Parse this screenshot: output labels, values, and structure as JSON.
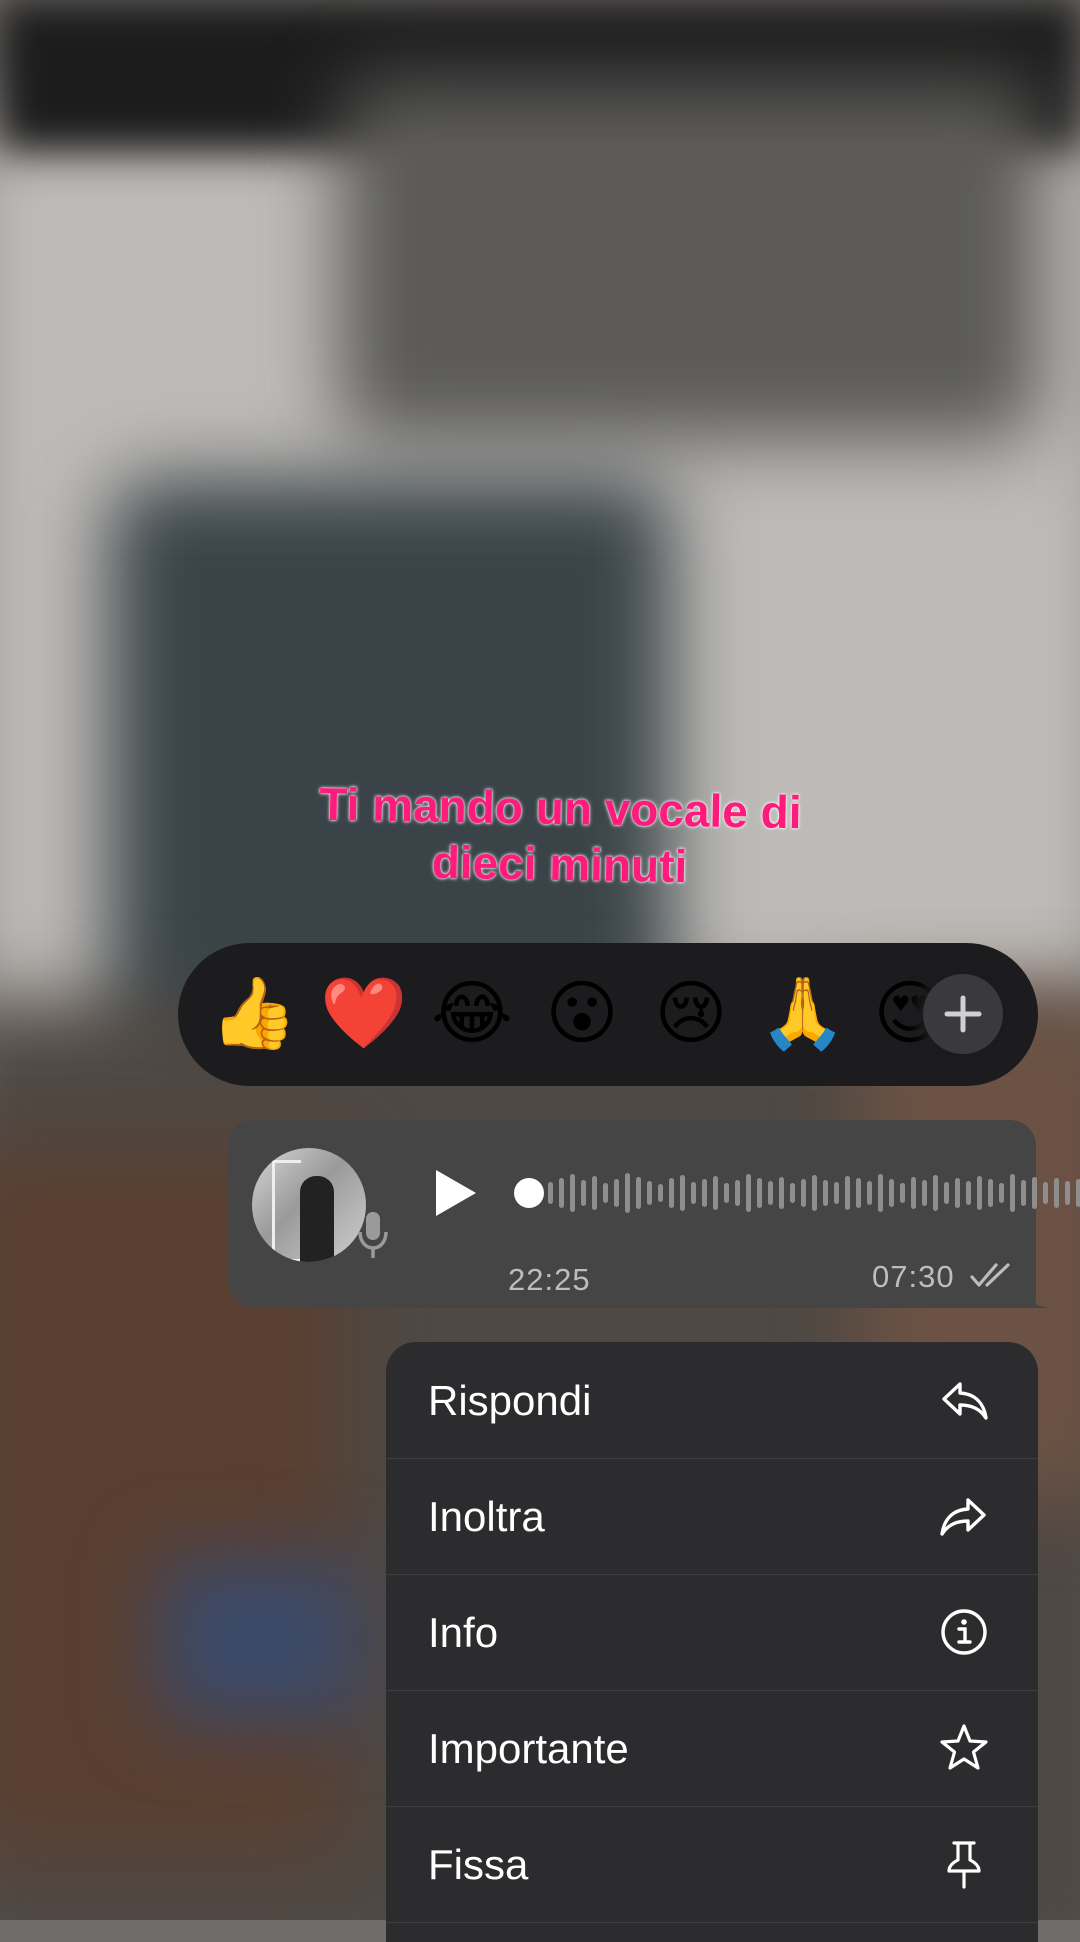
{
  "caption": {
    "line1": "Ti mando un vocale di",
    "line2": "dieci minuti"
  },
  "reactions": {
    "emojis": [
      "👍",
      "❤️",
      "😂",
      "😮",
      "😢",
      "🙏",
      "😍"
    ],
    "more_icon": "plus-icon"
  },
  "voice_message": {
    "duration": "22:25",
    "time": "07:30",
    "status_icon": "double-check-icon",
    "progress": 0
  },
  "menu": {
    "items": [
      {
        "label": "Rispondi",
        "icon": "reply-icon"
      },
      {
        "label": "Inoltra",
        "icon": "forward-icon"
      },
      {
        "label": "Info",
        "icon": "info-icon"
      },
      {
        "label": "Importante",
        "icon": "star-icon"
      },
      {
        "label": "Fissa",
        "icon": "pin-icon"
      }
    ]
  },
  "colors": {
    "caption": "#ff1b7c",
    "menu_bg": "#2c2c2e",
    "bubble_bg": "#454545",
    "reaction_bar_bg": "#1c1c1e"
  }
}
